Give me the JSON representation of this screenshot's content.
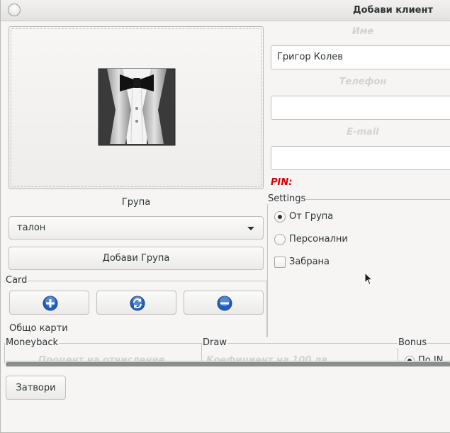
{
  "window": {
    "title": "Добави клиент"
  },
  "client": {
    "group_label": "Група",
    "group_selected": "талон",
    "add_group_label": "Добави Група"
  },
  "card": {
    "label": "Card",
    "total_label": "Общо карти"
  },
  "fields": {
    "name_header": "Име",
    "name_value": "Григор Колев",
    "phone_header": "Телефон",
    "phone_value": "",
    "email_header": "E-mail",
    "email_value": "",
    "pin_label": "PIN:"
  },
  "settings": {
    "label": "Settings",
    "option_group": "От Група",
    "option_personal": "Персонални",
    "option_banned": "Забрана",
    "selected": "От Група",
    "banned_checked": false
  },
  "sections": {
    "moneyback_label": "Moneyback",
    "moneyback_header": "Процент на отчисление",
    "draw_label": "Draw",
    "draw_header": "Коефициент на 100 лв",
    "bonus_label": "Bonus",
    "bonus_option": "По IN"
  },
  "footer": {
    "close_label": "Затвори"
  },
  "colors": {
    "pin": "#d40000",
    "placeholder_header": "#d3d2cf",
    "icon_blue": "#1f5fc4"
  },
  "icons": {
    "avatar": "tuxedo-icon",
    "add": "plus-circle-icon",
    "refresh": "refresh-circle-icon",
    "remove": "minus-circle-icon"
  }
}
